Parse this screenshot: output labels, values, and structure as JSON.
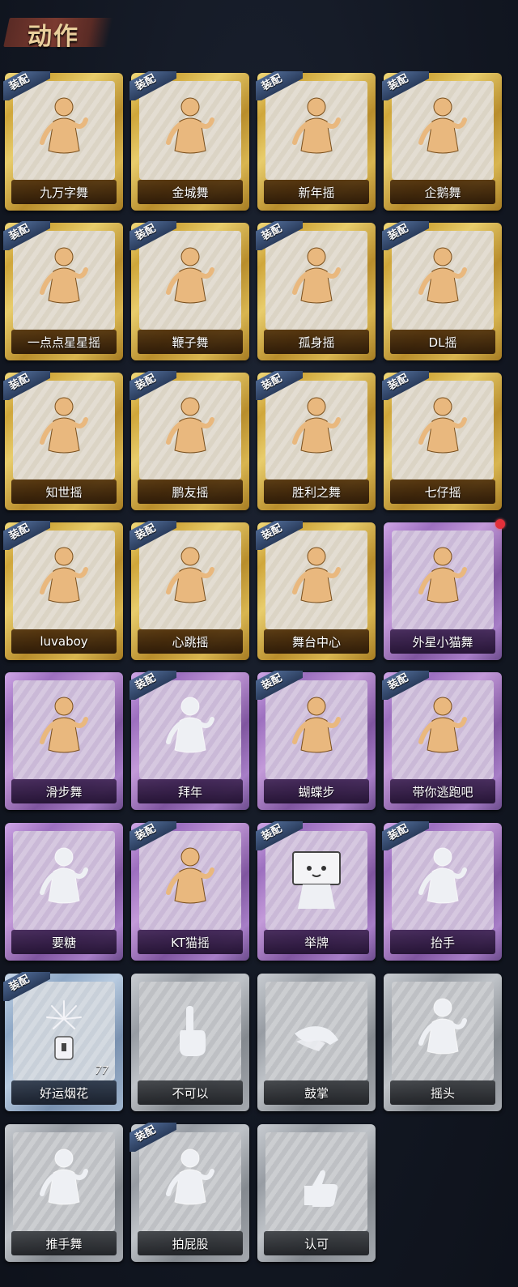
{
  "header": {
    "title": "动作"
  },
  "equip_label": "装配",
  "cards": [
    {
      "label": "九万字舞",
      "tier": "gold",
      "equipped": true,
      "icon": "dancer-figure-icon"
    },
    {
      "label": "金城舞",
      "tier": "gold",
      "equipped": true,
      "icon": "dancer-figure-icon"
    },
    {
      "label": "新年摇",
      "tier": "gold",
      "equipped": true,
      "icon": "dancer-figure-icon"
    },
    {
      "label": "企鹅舞",
      "tier": "gold",
      "equipped": true,
      "icon": "dancer-figure-icon"
    },
    {
      "label": "一点点星星摇",
      "tier": "gold",
      "equipped": true,
      "icon": "dancer-figure-icon"
    },
    {
      "label": "鞭子舞",
      "tier": "gold",
      "equipped": true,
      "icon": "dancer-figure-icon"
    },
    {
      "label": "孤身摇",
      "tier": "gold",
      "equipped": true,
      "icon": "dancer-figure-icon"
    },
    {
      "label": "DL摇",
      "tier": "gold",
      "equipped": true,
      "icon": "dancer-figure-icon"
    },
    {
      "label": "知世摇",
      "tier": "gold",
      "equipped": true,
      "icon": "dancer-figure-icon"
    },
    {
      "label": "鹏友摇",
      "tier": "gold",
      "equipped": true,
      "icon": "dancer-figure-icon"
    },
    {
      "label": "胜利之舞",
      "tier": "gold",
      "equipped": true,
      "icon": "dancer-figure-icon"
    },
    {
      "label": "七仔摇",
      "tier": "gold",
      "equipped": true,
      "icon": "dancer-figure-icon"
    },
    {
      "label": "luvaboy",
      "tier": "gold",
      "equipped": true,
      "icon": "dancer-figure-icon"
    },
    {
      "label": "心跳摇",
      "tier": "gold",
      "equipped": true,
      "icon": "dancer-figure-icon"
    },
    {
      "label": "舞台中心",
      "tier": "gold",
      "equipped": true,
      "icon": "dancer-figure-icon"
    },
    {
      "label": "外星小猫舞",
      "tier": "purple",
      "equipped": false,
      "new": true,
      "icon": "dancer-figure-icon"
    },
    {
      "label": "滑步舞",
      "tier": "purple",
      "equipped": false,
      "icon": "dancer-figure-icon"
    },
    {
      "label": "拜年",
      "tier": "purple",
      "equipped": true,
      "icon": "silhouette-figure-icon",
      "dim": true
    },
    {
      "label": "蝴蝶步",
      "tier": "purple",
      "equipped": true,
      "icon": "dancer-figure-icon"
    },
    {
      "label": "带你逃跑吧",
      "tier": "purple",
      "equipped": true,
      "icon": "dancer-figure-icon"
    },
    {
      "label": "要糖",
      "tier": "purple",
      "equipped": false,
      "icon": "silhouette-figure-icon",
      "dim": true
    },
    {
      "label": "KT猫摇",
      "tier": "purple",
      "equipped": true,
      "icon": "dancer-figure-icon"
    },
    {
      "label": "举牌",
      "tier": "purple",
      "equipped": true,
      "icon": "sign-figure-icon",
      "dim": true
    },
    {
      "label": "抬手",
      "tier": "purple",
      "equipped": true,
      "icon": "silhouette-figure-icon",
      "dim": true
    },
    {
      "label": "好运烟花",
      "tier": "blue",
      "equipped": true,
      "icon": "firework-icon",
      "count": "77"
    },
    {
      "label": "不可以",
      "tier": "gray",
      "equipped": false,
      "icon": "finger-wag-icon",
      "dim": true
    },
    {
      "label": "鼓掌",
      "tier": "gray",
      "equipped": false,
      "icon": "clap-hands-icon",
      "dim": true
    },
    {
      "label": "摇头",
      "tier": "gray",
      "equipped": false,
      "icon": "silhouette-figure-icon",
      "dim": true
    },
    {
      "label": "推手舞",
      "tier": "gray",
      "equipped": false,
      "icon": "silhouette-figure-icon",
      "dim": true
    },
    {
      "label": "拍屁股",
      "tier": "gray",
      "equipped": true,
      "icon": "silhouette-figure-icon",
      "dim": true
    },
    {
      "label": "认可",
      "tier": "gray",
      "equipped": false,
      "icon": "thumbs-up-icon",
      "dim": true
    }
  ]
}
